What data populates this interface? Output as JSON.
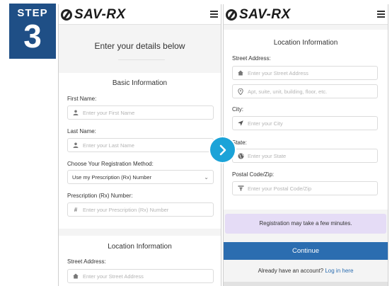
{
  "step": {
    "label": "STEP",
    "number": "3"
  },
  "brand": {
    "name": "SAV-RX"
  },
  "colors": {
    "step_bg": "#1f4f86",
    "primary": "#2b6db0",
    "next": "#1ba3d8",
    "notice": "#e5dcf6"
  },
  "left": {
    "header_title": "Enter your details below",
    "basic": {
      "title": "Basic Information",
      "first_name_label": "First Name:",
      "first_name_placeholder": "Enter your First Name",
      "last_name_label": "Last Name:",
      "last_name_placeholder": "Enter your Last Name",
      "method_label": "Choose Your Registration Method:",
      "method_value": "Use my Prescription (Rx) Number",
      "rx_label": "Prescription (Rx) Number:",
      "rx_placeholder": "Enter your Prescription (Rx) Number"
    },
    "location": {
      "title": "Location Information",
      "street_label": "Street Address:",
      "street_placeholder": "Enter your Street Address"
    }
  },
  "right": {
    "location": {
      "title": "Location Information",
      "street_label": "Street Address:",
      "street_placeholder": "Enter your Street Address",
      "apt_placeholder": "Apt, suite, unit, building, floor, etc.",
      "city_label": "City:",
      "city_placeholder": "Enter your City",
      "state_label": "State:",
      "state_placeholder": "Enter your State",
      "zip_label": "Postal Code/Zip:",
      "zip_placeholder": "Enter your Postal Code/Zip"
    },
    "notice": "Registration may take a few minutes.",
    "continue_label": "Continue",
    "login_prompt": "Already have an account?",
    "login_link": "Log in here"
  },
  "icons": {
    "user": "user-icon",
    "hash": "hash-icon",
    "home": "home-icon",
    "pin": "map-pin-icon",
    "arrow": "location-arrow-icon",
    "globe": "globe-icon",
    "zip": "postal-code-icon",
    "chevron": "chevron-down-icon",
    "next": "chevron-right-icon"
  }
}
